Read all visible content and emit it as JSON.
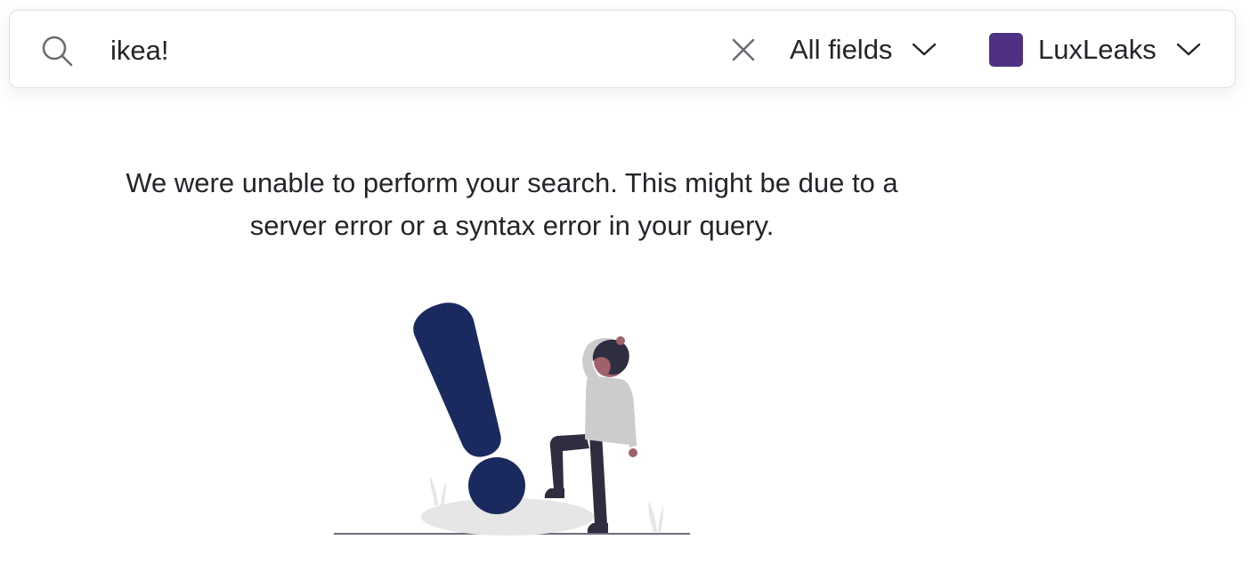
{
  "search": {
    "query": "ikea!",
    "field_scope": "All fields",
    "dataset": {
      "name": "LuxLeaks",
      "color": "#4e3183"
    }
  },
  "error": {
    "message": "We were unable to perform your search. This might be due to a server error or a syntax error in your query."
  },
  "illustration": {
    "accent_color": "#1a2a5e",
    "icon": "exclamation-person-illustration"
  }
}
